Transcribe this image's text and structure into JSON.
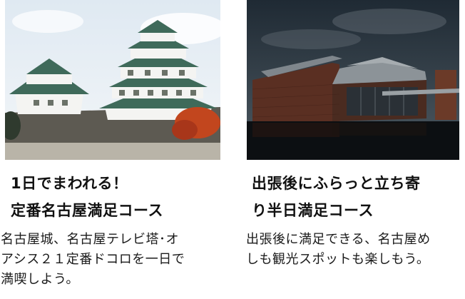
{
  "colors": {
    "castle_sky": "#e8f0f7",
    "castle_roof": "#3f6a5a",
    "castle_wall": "#f4f4f2",
    "castle_stone": "#5d5a52",
    "autumn_tree": "#c2461e",
    "museum_sky": "#2b3540",
    "museum_brick": "#5a2f22",
    "museum_roof": "#7f868c",
    "museum_water": "#0c0f12"
  },
  "cards": [
    {
      "image_icon": "nagoya-castle-photo",
      "title_lines": [
        "1日でまわれる！",
        "定番名古屋満足コース"
      ],
      "desc_lines": [
        "名古屋城、名古屋テレビ塔･オ",
        "アシス２１定番ドコロを一日で",
        "満喫しよう。"
      ]
    },
    {
      "image_icon": "brick-building-photo",
      "title_lines": [
        "出張後にふらっと立ち寄",
        "り半日満足コース"
      ],
      "desc_lines": [
        "出張後に満足できる、名古屋め",
        "しも観光スポットも楽しもう。"
      ]
    }
  ]
}
